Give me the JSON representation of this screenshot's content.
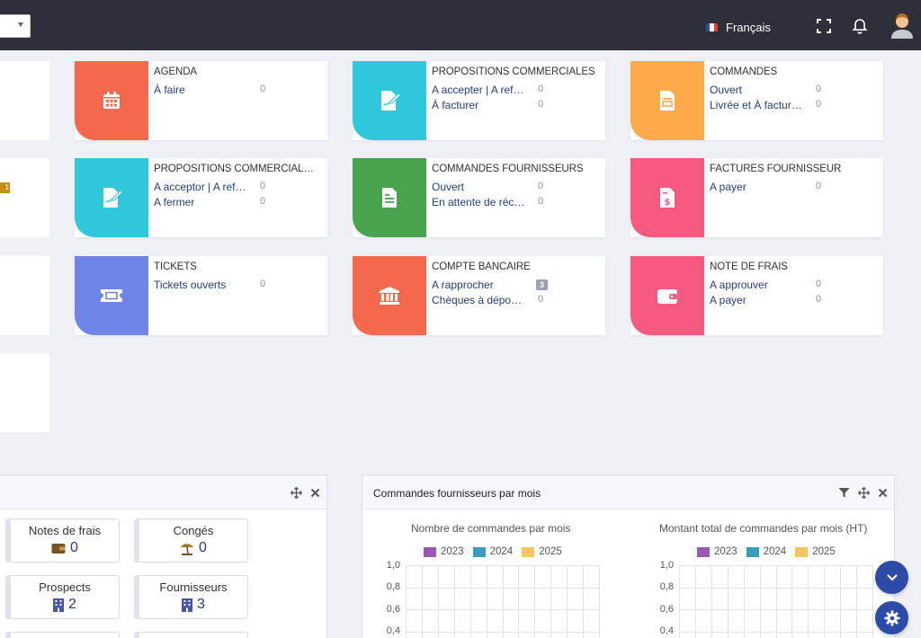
{
  "topbar": {
    "language_label": "Français",
    "icons": [
      "fullscreen-icon",
      "bell-icon",
      "user-avatar"
    ]
  },
  "widgets": [
    {
      "id": "agenda",
      "title": "AGENDA",
      "color": "#f4694d",
      "icon": "calendar-icon",
      "rows": [
        {
          "label": "À faire",
          "count": "0"
        }
      ]
    },
    {
      "id": "propal",
      "title": "PROPOSITIONS COMMERCIALES",
      "color": "#2fc7db",
      "icon": "signature-doc-icon",
      "rows": [
        {
          "label": "A accepter | A ref…",
          "count": "0"
        },
        {
          "label": "À facturer",
          "count": "0"
        }
      ]
    },
    {
      "id": "commandes",
      "title": "COMMANDES",
      "color": "#fcaa4a",
      "icon": "order-doc-icon",
      "rows": [
        {
          "label": "Ouvert",
          "count": "0"
        },
        {
          "label": "Livrée et À factur…",
          "count": "0"
        }
      ]
    },
    {
      "id": "propal-fourn",
      "title": "PROPOSITIONS COMMERCIALE…",
      "color": "#2fc7db",
      "icon": "signature-doc-icon",
      "rows": [
        {
          "label": "A acceptor | A ref…",
          "count": "0"
        },
        {
          "label": "A fermer",
          "count": "0"
        }
      ]
    },
    {
      "id": "cmd-fourn",
      "title": "COMMANDES FOURNISSEURS",
      "color": "#49a54d",
      "icon": "supplier-order-icon",
      "rows": [
        {
          "label": "Ouvert",
          "count": "0"
        },
        {
          "label": "En attente de réc…",
          "count": "0"
        }
      ]
    },
    {
      "id": "fact-fourn",
      "title": "FACTURES FOURNISSEUR",
      "color": "#f55a7e",
      "icon": "invoice-dollar-icon",
      "rows": [
        {
          "label": "A payer",
          "count": "0"
        }
      ]
    },
    {
      "id": "tickets",
      "title": "TICKETS",
      "color": "#6e84e6",
      "icon": "ticket-icon",
      "rows": [
        {
          "label": "Tickets ouverts",
          "count": "0"
        }
      ]
    },
    {
      "id": "banque",
      "title": "COMPTE BANCAIRE",
      "color": "#f4694d",
      "icon": "bank-icon",
      "rows": [
        {
          "label": "A rapprocher",
          "count": "3",
          "badge": true
        },
        {
          "label": "Chèques à dépo…",
          "count": "0"
        }
      ]
    },
    {
      "id": "ndf",
      "title": "NOTE DE FRAIS",
      "color": "#f55a7e",
      "icon": "wallet-icon",
      "rows": [
        {
          "label": "A approuver",
          "count": "0"
        },
        {
          "label": "A payer",
          "count": "0"
        }
      ]
    }
  ],
  "cut_badge": "1",
  "stats": [
    {
      "label": "Notes de frais",
      "value": "0",
      "icon": "wallet-icon"
    },
    {
      "label": "Congés",
      "value": "0",
      "icon": "beach-icon"
    },
    {
      "label": "Prospects",
      "value": "2",
      "icon": "building-icon"
    },
    {
      "label": "Fournisseurs",
      "value": "3",
      "icon": "building-icon"
    }
  ],
  "chart_panel": {
    "title": "Commandes fournisseurs par mois"
  },
  "chart_data": [
    {
      "type": "bar",
      "title": "Nombre de commandes par mois",
      "series": [
        {
          "name": "2023",
          "color": "#9b59b6",
          "values": []
        },
        {
          "name": "2024",
          "color": "#3a9bc1",
          "values": []
        },
        {
          "name": "2025",
          "color": "#f8c365",
          "values": []
        }
      ],
      "yticks": [
        "1,0",
        "0,8",
        "0,6",
        "0,4"
      ],
      "ylim": [
        0,
        1
      ],
      "grid": true,
      "legend": "top"
    },
    {
      "type": "bar",
      "title": "Montant total de commandes par mois (HT)",
      "series": [
        {
          "name": "2023",
          "color": "#9b59b6",
          "values": []
        },
        {
          "name": "2024",
          "color": "#3a9bc1",
          "values": []
        },
        {
          "name": "2025",
          "color": "#f8c365",
          "values": []
        }
      ],
      "yticks": [
        "1,0",
        "0,8",
        "0,6",
        "0,4"
      ],
      "ylim": [
        0,
        1
      ],
      "grid": true,
      "legend": "top"
    }
  ]
}
